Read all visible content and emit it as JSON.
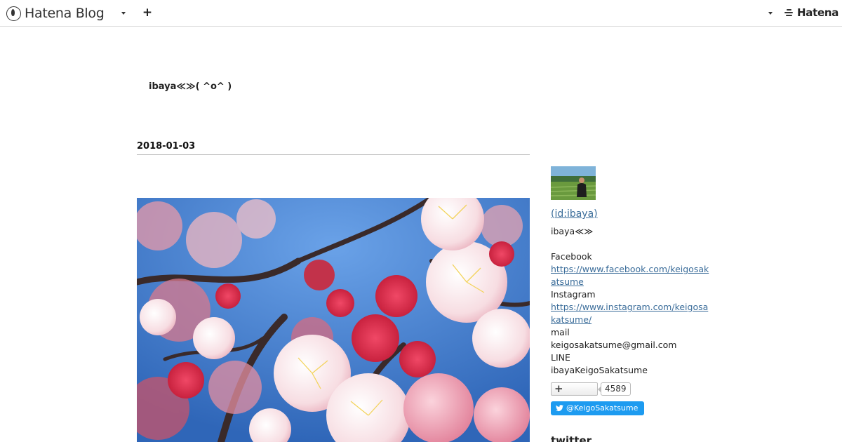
{
  "topbar": {
    "brand_name": "Hatena Blog",
    "hatena_logo": "Hatena",
    "icons": {
      "brand": "hatena-blog-logo-icon",
      "menu": "caret-down-icon",
      "add": "plus-icon"
    }
  },
  "blog": {
    "title": "ibaya≪≫( ^o^ )"
  },
  "entry": {
    "date": "2018-01-03"
  },
  "profile": {
    "id": " (id:ibaya)",
    "name": "ibaya≪≫",
    "facebook_label": "Facebook",
    "facebook_url_1": "https://www.facebook.com/keigosak",
    "facebook_url_2": "atsume",
    "instagram_label": "Instagram",
    "instagram_url_1": "https://www.instagram.com/keigosa",
    "instagram_url_2": "katsume/",
    "mail_label": "mail",
    "mail_value": "keigosakatsume@gmail.com",
    "line_label": "LINE",
    "line_value": "ibayaKeigoSakatsume",
    "subscriber_count": "4589",
    "twitter_button": "@KeigoSakatsume",
    "twitter_heading": "twitter"
  },
  "colors": {
    "link": "#3b6d9a",
    "twitter": "#1d9bf0",
    "rule": "#bbbbbb"
  }
}
